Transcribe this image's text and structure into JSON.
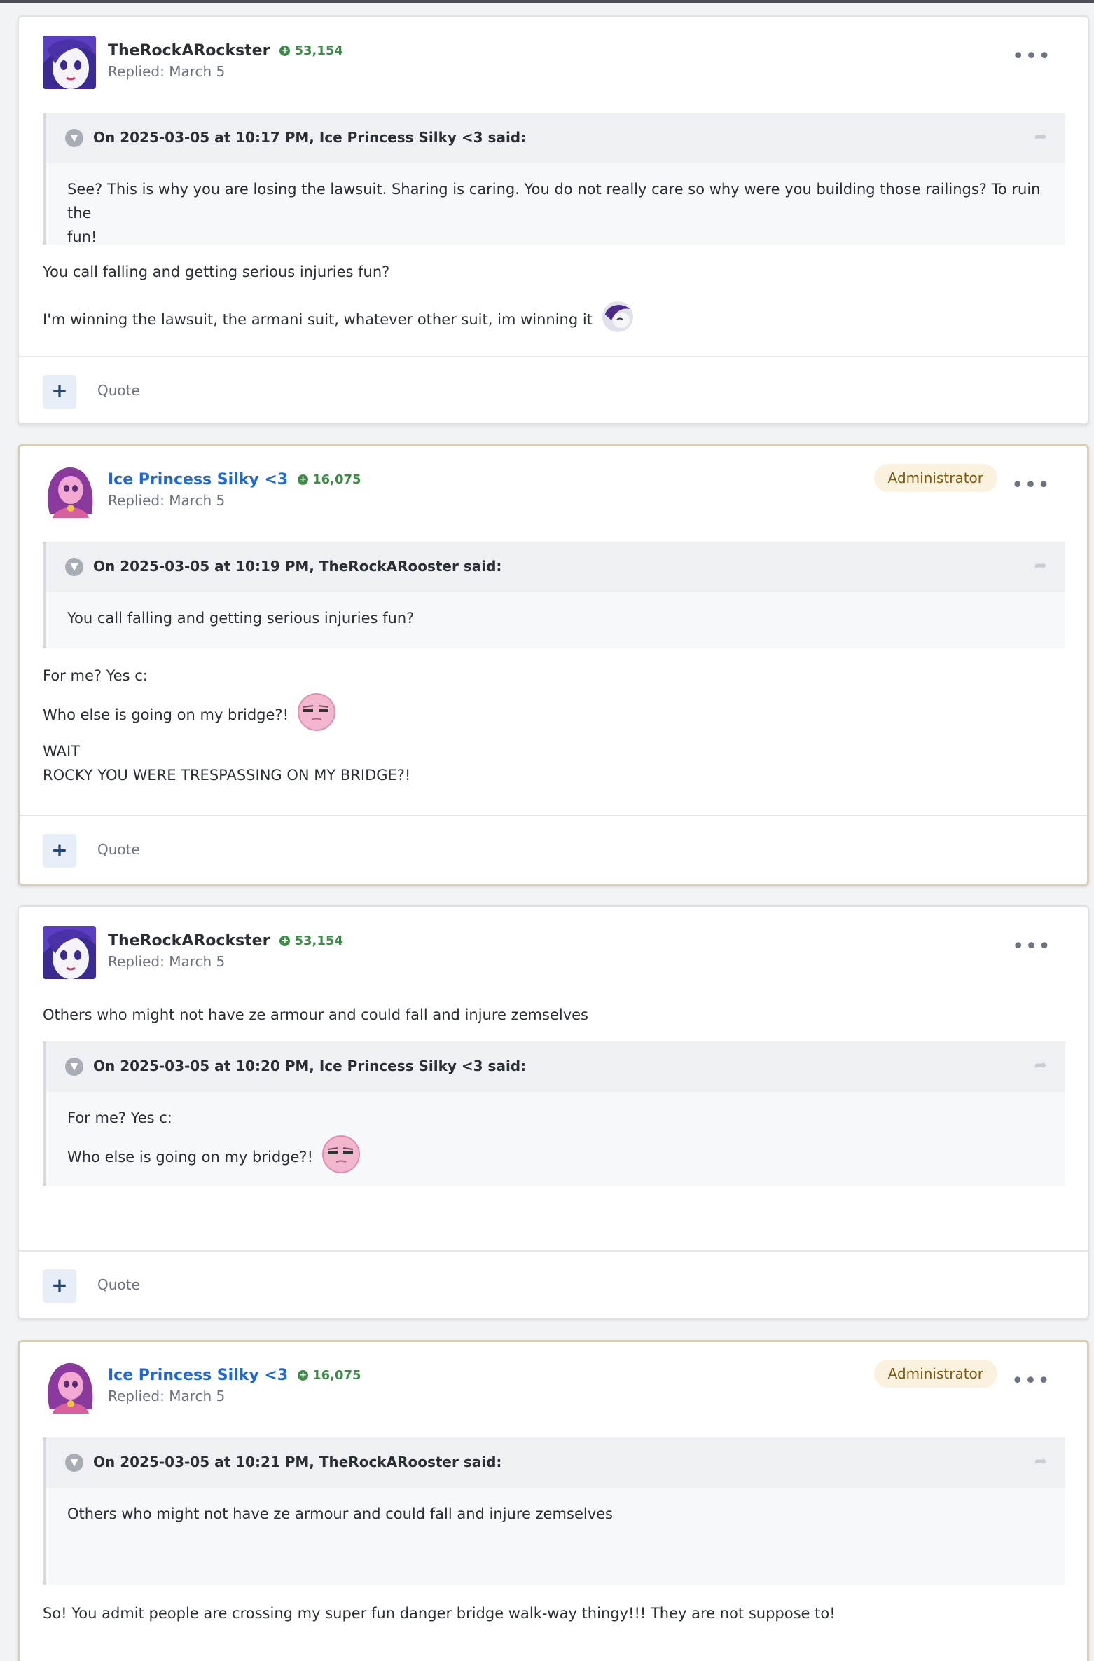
{
  "posts": [
    {
      "author": "TheRockARockster",
      "rep": "53,154",
      "replied": "Replied: March 5",
      "badge": "",
      "quote_title": "On 2025-03-05 at 10:17 PM, Ice Princess Silky <3 said:",
      "quote_lines": [
        "See? This is why you are losing the lawsuit. Sharing is caring. You do not really care so why were you building those railings? To ruin the",
        "fun!"
      ],
      "before_quote_lines": [],
      "body_lines": [
        "You call falling and getting serious injuries fun?",
        "I'm winning the lawsuit, the armani suit, whatever other suit, im winning it"
      ],
      "quote_label": "Quote"
    },
    {
      "author": "Ice Princess Silky <3",
      "rep": "16,075",
      "replied": "Replied: March 5",
      "badge": "Administrator",
      "quote_title": "On 2025-03-05 at 10:19 PM, TheRockARooster said:",
      "quote_lines": [
        "You call falling and getting serious injuries fun?"
      ],
      "before_quote_lines": [],
      "body_lines": [
        "For me? Yes c:",
        "Who else is going on my bridge?!",
        "WAIT",
        "ROCKY YOU WERE TRESPASSING ON MY BRIDGE?!"
      ],
      "quote_label": "Quote"
    },
    {
      "author": "TheRockARockster",
      "rep": "53,154",
      "replied": "Replied: March 5",
      "badge": "",
      "quote_title": "On 2025-03-05 at 10:20 PM, Ice Princess Silky <3 said:",
      "quote_lines": [
        "For me? Yes c:",
        "Who else is going on my bridge?!"
      ],
      "before_quote_lines": [
        "Others who might not have ze armour and could fall and injure zemselves"
      ],
      "body_lines": [],
      "quote_label": "Quote"
    },
    {
      "author": "Ice Princess Silky <3",
      "rep": "16,075",
      "replied": "Replied: March 5",
      "badge": "Administrator",
      "quote_title": "On 2025-03-05 at 10:21 PM, TheRockARooster said:",
      "quote_lines": [
        "Others who might not have ze armour and could fall and injure zemselves"
      ],
      "before_quote_lines": [],
      "body_lines": [
        "So! You admit people are crossing my super fun danger bridge walk-way thingy!!! They are not suppose to!"
      ],
      "quote_label": "Quote"
    }
  ],
  "icons": {
    "more": "more-options-icon",
    "collapse": "chevron-down-icon",
    "share": "share-icon",
    "plus": "plus-icon",
    "rep": "reputation-plus-icon"
  },
  "colors": {
    "admin_name": "#1f67d3",
    "reputation": "#3e8a48",
    "admin_badge_bg": "#fbf1df",
    "admin_border": "#d8cdb8"
  }
}
